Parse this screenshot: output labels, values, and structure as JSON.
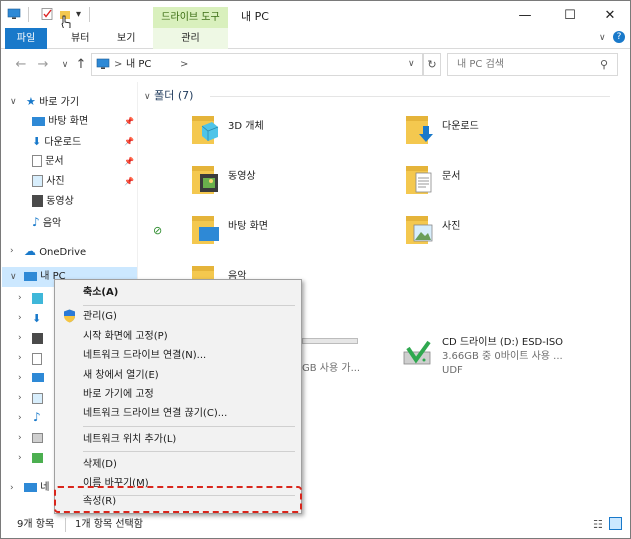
{
  "window": {
    "title": "내 PC",
    "context_tab_group": "드라이브 도구",
    "minimize": "—",
    "maximize": "☐",
    "close": "✕"
  },
  "ribbon": {
    "tabs": {
      "file": "파일",
      "view_partial": "뷰터",
      "view": "보기",
      "manage": "관리"
    }
  },
  "address": {
    "path_sep": ">",
    "location": "내 PC",
    "search_placeholder": "내 PC 검색"
  },
  "nav_pane": {
    "quick_access": "바로 가기",
    "quick_items": [
      {
        "label": "바탕 화면",
        "pinned": true
      },
      {
        "label": "다운로드",
        "pinned": true
      },
      {
        "label": "문서",
        "pinned": true
      },
      {
        "label": "사진",
        "pinned": true
      },
      {
        "label": "동영상",
        "pinned": false
      },
      {
        "label": "음악",
        "pinned": false
      }
    ],
    "onedrive": "OneDrive",
    "this_pc": "내 PC",
    "network_partial": "네"
  },
  "content": {
    "group_header": "폴더 (7)",
    "folders": [
      {
        "label": "3D 개체"
      },
      {
        "label": "다운로드"
      },
      {
        "label": "동영상"
      },
      {
        "label": "문서"
      },
      {
        "label": "바탕 화면"
      },
      {
        "label": "사진"
      },
      {
        "label": "음악"
      }
    ],
    "drive_c_partial": "GB 사용 가...",
    "drive_d": {
      "name": "CD 드라이브 (D:) ESD-ISO",
      "usage": "3.66GB 중 0바이트 사용 ...",
      "fs": "UDF"
    }
  },
  "context_menu": {
    "items": [
      {
        "label": "축소(A)",
        "bold": true
      },
      {
        "label": "관리(G)",
        "icon": "shield-icon"
      },
      {
        "label": "시작 화면에 고정(P)"
      },
      {
        "label": "네트워크 드라이브 연결(N)..."
      },
      {
        "label": "새 창에서 열기(E)"
      },
      {
        "label": "바로 가기에 고정"
      },
      {
        "label": "네트워크 드라이브 연결 끊기(C)..."
      },
      {
        "label": "네트워크 위치 추가(L)"
      },
      {
        "label": "삭제(D)"
      },
      {
        "label": "이름 바꾸기(M)"
      },
      {
        "label": "속성(R)"
      }
    ]
  },
  "status": {
    "count": "9개 항목",
    "selection": "1개 항목 선택함"
  },
  "colors": {
    "file_tab": "#1979ca",
    "context_tab": "#d9f0bd",
    "selection": "#cce8ff",
    "highlight_border": "#d9261c",
    "folder_yellow": "#f4c84f"
  }
}
